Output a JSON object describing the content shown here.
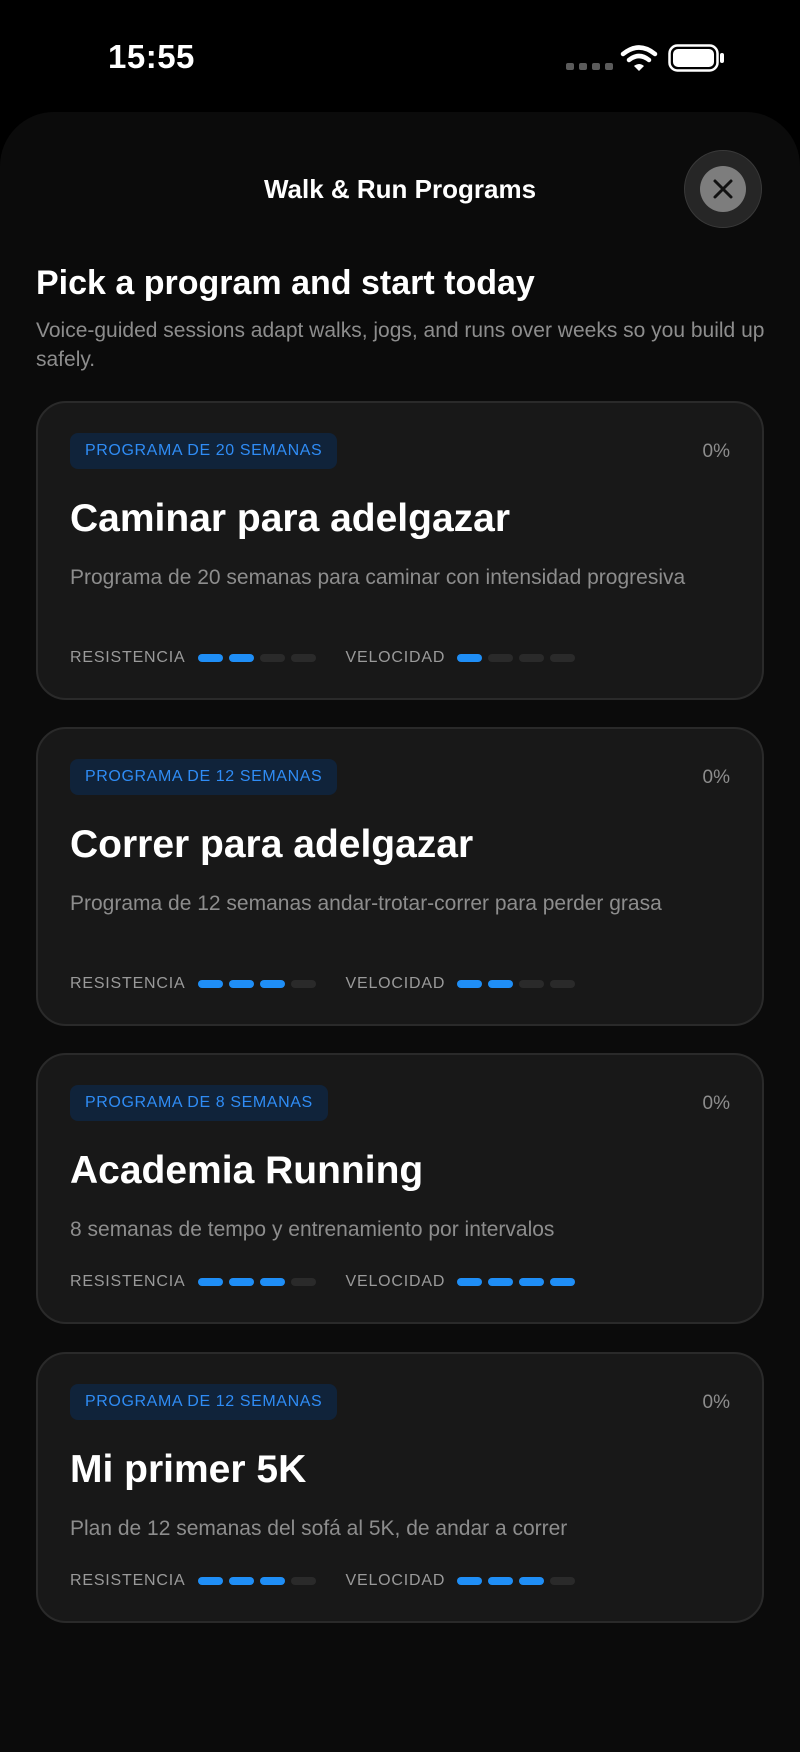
{
  "status_bar": {
    "time": "15:55",
    "icons": [
      "cellular-signal-icon",
      "wifi-icon",
      "battery-icon"
    ]
  },
  "sheet": {
    "title": "Walk & Run Programs",
    "close_icon": "close-icon"
  },
  "intro": {
    "headline": "Pick a program and start today",
    "subheadline": "Voice-guided sessions adapt walks, jogs, and runs over weeks so you build up safely."
  },
  "labels": {
    "resistance": "RESISTENCIA",
    "speed": "VELOCIDAD"
  },
  "programs": [
    {
      "badge": "PROGRAMA DE 20 SEMANAS",
      "progress": "0%",
      "title": "Caminar para adelgazar",
      "description": "Programa de 20 semanas para caminar con intensidad progresiva",
      "resistance_level": 2,
      "speed_level": 1
    },
    {
      "badge": "PROGRAMA DE 12 SEMANAS",
      "progress": "0%",
      "title": "Correr para adelgazar",
      "description": "Programa de 12 semanas andar-trotar-correr para perder grasa",
      "resistance_level": 3,
      "speed_level": 2
    },
    {
      "badge": "PROGRAMA DE 8 SEMANAS",
      "progress": "0%",
      "title": "Academia Running",
      "description": "8 semanas de tempo y entrenamiento por intervalos",
      "resistance_level": 3,
      "speed_level": 4
    },
    {
      "badge": "PROGRAMA DE 12 SEMANAS",
      "progress": "0%",
      "title": "Mi primer 5K",
      "description": "Plan de 12 semanas del sofá al 5K, de andar a correr",
      "resistance_level": 3,
      "speed_level": 3
    }
  ],
  "meter_max": 4,
  "colors": {
    "accent": "#1f8ef6",
    "badge_background": "#10233a",
    "card_background": "#181818",
    "meter_off": "#2a2a2a"
  }
}
